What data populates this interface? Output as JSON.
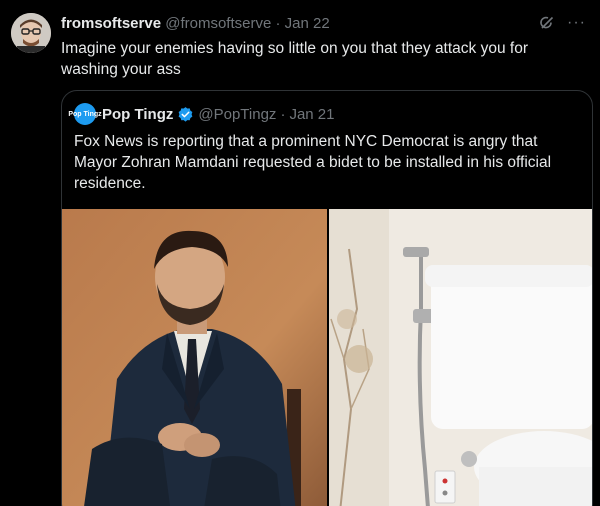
{
  "tweet": {
    "display_name": "fromsoftserve",
    "handle": "@fromsoftserve",
    "separator": "·",
    "date": "Jan 22",
    "text": "Imagine your enemies having so little on you that they attack you for washing your ass",
    "more_label": "···"
  },
  "quote": {
    "avatar_text": "Pop Tingz",
    "display_name": "Pop Tingz",
    "handle": "@PopTingz",
    "separator": "·",
    "date": "Jan 21",
    "text": "Fox News is reporting that a prominent NYC Democrat is angry that Mayor Zohran Mamdani requested a bidet to be installed in his official residence."
  },
  "colors": {
    "background": "#000000",
    "text_primary": "#e7e9ea",
    "text_secondary": "#71767b",
    "border": "#2f3336",
    "verified": "#1d9bf0"
  },
  "icons": {
    "grok": "grok-icon",
    "more": "more-icon",
    "verified": "verified-badge-icon"
  }
}
